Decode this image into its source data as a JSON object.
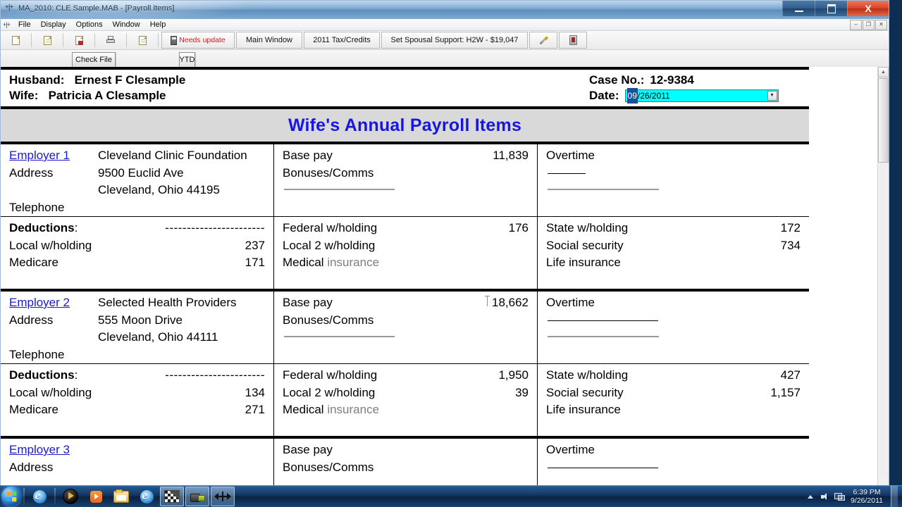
{
  "window": {
    "title": "MA_2010: CLE Sample.MAB - [Payroll Items]",
    "minimize_label": "–",
    "maximize_label": "❐",
    "close_label": "X"
  },
  "menu": {
    "items": [
      "File",
      "Display",
      "Options",
      "Window",
      "Help"
    ],
    "mdi_buttons": [
      "–",
      "❐",
      "✕"
    ]
  },
  "toolbar": {
    "icons": [
      {
        "name": "new-document-icon",
        "label": ""
      },
      {
        "name": "open-document-icon",
        "label": ""
      },
      {
        "name": "save-document-icon",
        "label": ""
      },
      {
        "name": "print-icon",
        "label": ""
      },
      {
        "name": "preview-document-icon",
        "label": ""
      }
    ],
    "needs_update_label": "Needs update",
    "main_window_label": "Main Window",
    "tax_credits_label": "2011 Tax/Credits",
    "spousal_support_label": "Set Spousal Support: H2W - $19,047",
    "pen_icon": "highlighter-pen-icon",
    "red_icon": "red-book-icon"
  },
  "toolbar2": {
    "check_file_label": "Check File",
    "check_file_accesskey": "C",
    "ytd_label": "YTD"
  },
  "header": {
    "husband_label": "Husband:",
    "husband_name": "Ernest F Clesample",
    "wife_label": "Wife:",
    "wife_name": "Patricia A Clesample",
    "case_label": "Case No.:",
    "case_number": "12-9384",
    "date_label": "Date:",
    "date_value_selected": "09",
    "date_value_rest": "/26/2011",
    "date_full": "09/26/2011",
    "date_field_bg": "#00ffff",
    "date_selection_bg": "#1a4f9c"
  },
  "banner": {
    "title": "Wife's Annual Payroll Items",
    "color": "#1717e0",
    "background": "#d9d9d9"
  },
  "labels": {
    "address": "Address",
    "telephone": "Telephone",
    "deductions": "Deductions",
    "deductions_colon": ":",
    "dashes": "-----------------------",
    "base_pay": "Base pay",
    "bonuses_comms": "Bonuses/Comms",
    "overtime": "Overtime",
    "federal_wh": "Federal w/holding",
    "local2_wh": "Local 2 w/holding",
    "medical": "Medical",
    "insurance": "insurance",
    "state_wh": "State w/holding",
    "social_security": "Social security",
    "life_insurance": "Life insurance",
    "local_wh": "Local w/holding",
    "medicare": "Medicare"
  },
  "employers": [
    {
      "link": "Employer 1",
      "name": "Cleveland Clinic Foundation",
      "address1": "9500 Euclid Ave",
      "address2": "Cleveland, Ohio 44195",
      "telephone": "",
      "base_pay": "11,839",
      "bonuses": "",
      "overtime": "",
      "federal_wh": "176",
      "local2_wh": "",
      "medical": "",
      "state_wh": "172",
      "social_security": "734",
      "life_insurance": "",
      "local_wh": "237",
      "medicare": "171"
    },
    {
      "link": "Employer 2",
      "name": "Selected Health Providers",
      "address1": "555 Moon Drive",
      "address2": "Cleveland, Ohio 44111",
      "telephone": "",
      "base_pay": "18,662",
      "bonuses": "",
      "overtime": "",
      "federal_wh": "1,950",
      "local2_wh": "39",
      "medical": "",
      "state_wh": "427",
      "social_security": "1,157",
      "life_insurance": "",
      "local_wh": "134",
      "medicare": "271"
    },
    {
      "link": "Employer 3",
      "name": "",
      "address1": "",
      "address2": "",
      "telephone": "",
      "base_pay": "",
      "bonuses": "",
      "overtime": "",
      "federal_wh": "",
      "local2_wh": "",
      "medical": "",
      "state_wh": "",
      "social_security": "",
      "life_insurance": "",
      "local_wh": "",
      "medicare": ""
    }
  ],
  "taskbar": {
    "start_label": "",
    "items": [
      {
        "name": "taskbar-internet-explorer-quicklaunch",
        "icon": "internet-explorer-icon"
      },
      {
        "name": "taskbar-media-player",
        "icon": "media-player-icon"
      },
      {
        "name": "taskbar-media-player-classic",
        "icon": "media-player-orange-icon"
      },
      {
        "name": "taskbar-explorer",
        "icon": "folder-icon"
      },
      {
        "name": "taskbar-internet-explorer",
        "icon": "internet-explorer-icon"
      },
      {
        "name": "taskbar-image-editor",
        "icon": "checker-image-icon"
      },
      {
        "name": "taskbar-camtasia",
        "icon": "camcorder-icon"
      },
      {
        "name": "taskbar-mab-app",
        "icon": "horizontal-arrows-icon"
      }
    ],
    "clock_time": "6:39 PM",
    "clock_date": "9/26/2011"
  }
}
